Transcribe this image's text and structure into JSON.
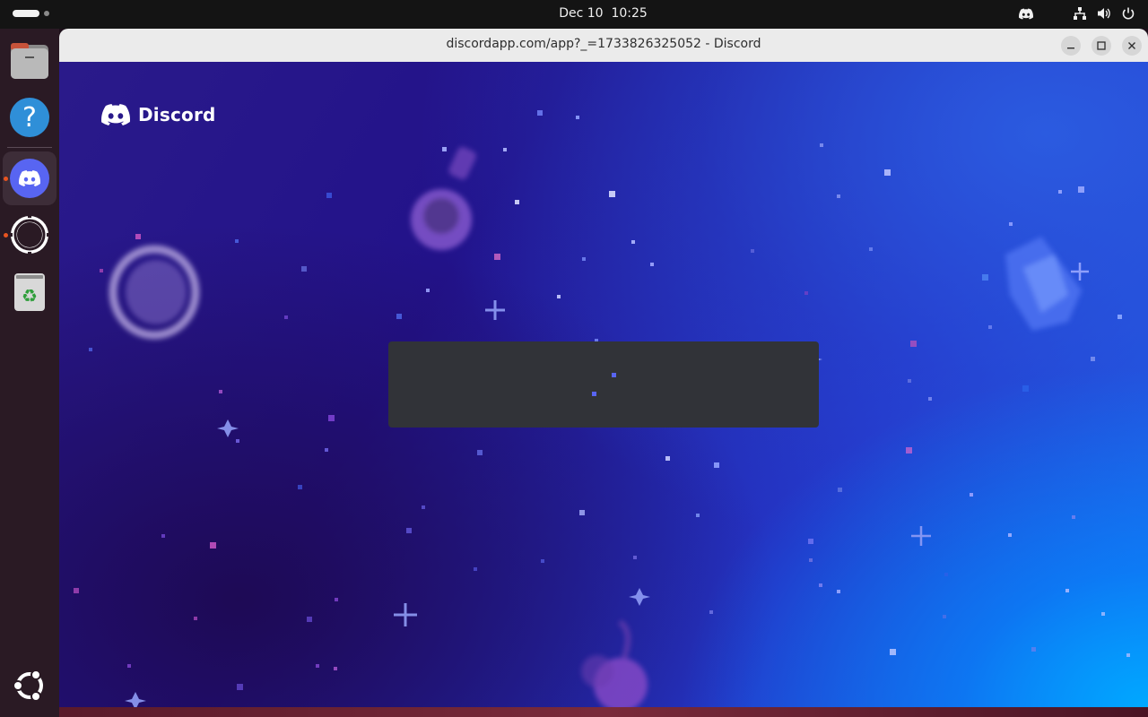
{
  "topbar": {
    "clock": "Dec 10  10:25",
    "tray_icons": [
      "discord-icon",
      "network-icon",
      "volume-icon",
      "power-icon"
    ]
  },
  "dock": {
    "items": [
      {
        "name": "files-icon",
        "running": false
      },
      {
        "name": "help-icon",
        "running": false
      },
      {
        "name": "discord-app-icon",
        "running": true,
        "active": true
      },
      {
        "name": "settings-icon",
        "running": true
      },
      {
        "name": "trash-icon",
        "running": false
      }
    ],
    "apps_grid": "ubuntu-logo-icon"
  },
  "window": {
    "title": "discordapp.com/app?_=1733826325052 - Discord",
    "controls": [
      "minimize",
      "maximize",
      "close"
    ]
  },
  "app": {
    "brand_name": "Discord",
    "loading": true,
    "accent_color": "#5865f2",
    "card_color": "#313338"
  }
}
